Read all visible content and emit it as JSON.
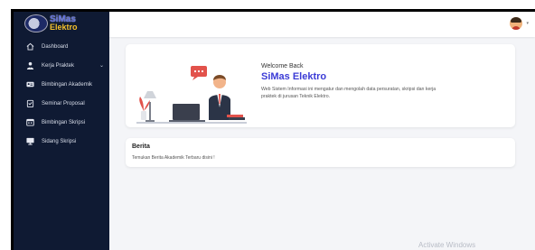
{
  "brand": {
    "line1": "SiMas",
    "line2": "Elektro"
  },
  "sidebar": {
    "items": [
      {
        "label": "Dashboard",
        "icon": "home-icon"
      },
      {
        "label": "Kerja Praktek",
        "icon": "user-tie-icon",
        "has_chevron": true
      },
      {
        "label": "Bimbingan Akademik",
        "icon": "id-card-icon"
      },
      {
        "label": "Seminar Proposal",
        "icon": "clipboard-icon"
      },
      {
        "label": "Bimbingan Skripsi",
        "icon": "calendar-icon"
      },
      {
        "label": "Sidang Skripsi",
        "icon": "monitor-icon"
      }
    ]
  },
  "welcome": {
    "greeting": "Welcome Back",
    "title": "SiMas Elektro",
    "description": "Web Sistem Informasi ini mengatur dan mengolah data persuratan, skripsi dan kerja praktek di jurusan Teknik Elektro."
  },
  "news": {
    "title": "Berita",
    "subtitle": "Temukan Berita Akademik Terbaru disini !"
  },
  "watermark": "Activate Windows",
  "colors": {
    "sidebar": "#0f1a33",
    "accent": "#3b3bd6",
    "background": "#f4f5f8"
  }
}
